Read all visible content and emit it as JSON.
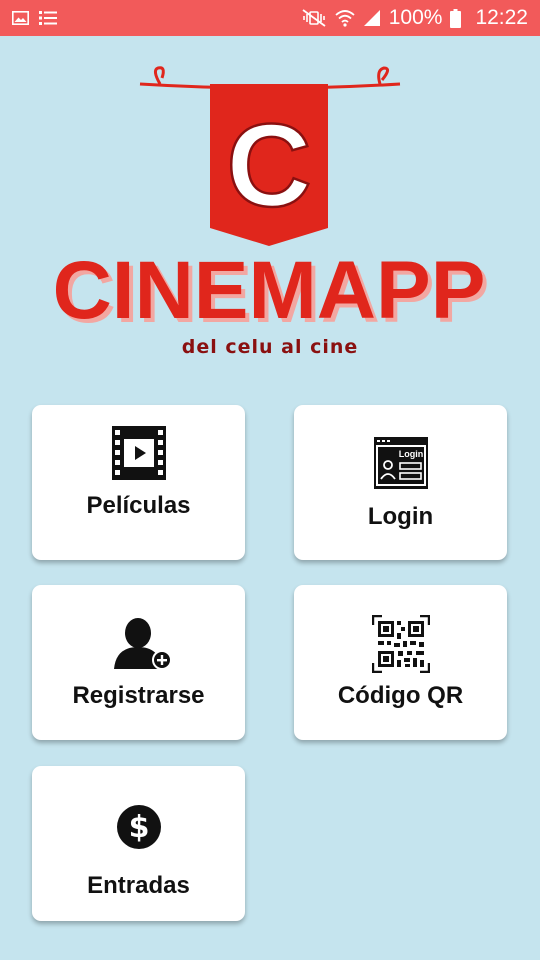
{
  "status_bar": {
    "battery_text": "100%",
    "time": "12:22",
    "background": "#f25a5a",
    "icons": [
      "image-icon",
      "list-icon",
      "mute-vibrate-icon",
      "wifi-icon",
      "signal-icon",
      "battery-icon"
    ]
  },
  "logo": {
    "letter": "C",
    "name": "CINEMAPP",
    "tagline": "del celu al cine",
    "brand_color": "#e0261c"
  },
  "menu": {
    "peliculas": {
      "label": "Películas",
      "icon": "film-play-icon"
    },
    "login": {
      "label": "Login",
      "icon": "login-window-icon",
      "icon_text": "Login"
    },
    "registrarse": {
      "label": "Registrarse",
      "icon": "add-user-icon"
    },
    "codigo_qr": {
      "label": "Código QR",
      "icon": "qr-code-icon"
    },
    "entradas": {
      "label": "Entradas",
      "icon": "dollar-coin-icon"
    }
  }
}
